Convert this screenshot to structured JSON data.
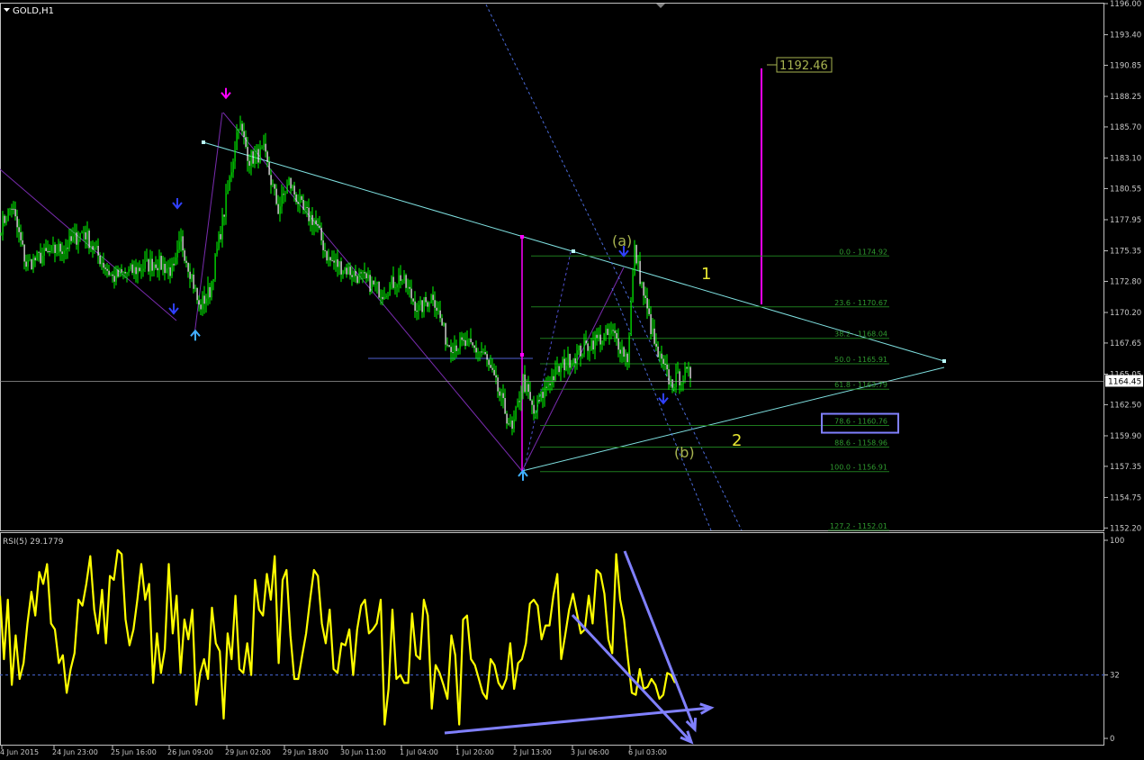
{
  "window": {
    "title": "GOLD,H1",
    "menu_icon": "triangle-down-icon"
  },
  "colors": {
    "background": "#000000",
    "frame": "#c0c0c0",
    "text": "#c8c8c8",
    "candle_bull": "#00ff00",
    "candle_bear": "#ffffff",
    "trendline": "#7fe0e0",
    "fib": "#1e7a1e",
    "fib_text": "#2f9a2f",
    "magenta": "#ff00ff",
    "rsi": "#ffff00",
    "arrow_blue": "#8080ff",
    "label_yellow": "#e8e832",
    "label_olive": "#a8b450"
  },
  "chart_data": [
    {
      "type": "candlestick",
      "symbol": "GOLD",
      "timeframe": "H1",
      "ylim": [
        1152.0,
        1196.0
      ],
      "y_ticks": [
        "1196.00",
        "1193.40",
        "1190.85",
        "1188.25",
        "1185.70",
        "1183.10",
        "1180.55",
        "1177.95",
        "1175.35",
        "1172.80",
        "1170.20",
        "1167.65",
        "1165.05",
        "1162.50",
        "1159.90",
        "1157.35",
        "1154.75",
        "1152.20"
      ],
      "x_ticks": [
        "4 Jun 2015",
        "24 Jun 23:00",
        "25 Jun 16:00",
        "26 Jun 09:00",
        "29 Jun 02:00",
        "29 Jun 18:00",
        "30 Jun 11:00",
        "1 Jul 04:00",
        "1 Jul 20:00",
        "2 Jul 13:00",
        "3 Jul 06:00",
        "6 Jul 03:00"
      ],
      "current_price": "1164.45",
      "current_price_value": 1164.45,
      "close_anchors": [
        [
          0,
          1177.4
        ],
        [
          6,
          1179.1
        ],
        [
          14,
          1174.2
        ],
        [
          24,
          1175.0
        ],
        [
          36,
          1175.7
        ],
        [
          46,
          1177.0
        ],
        [
          52,
          1175.4
        ],
        [
          62,
          1173.1
        ],
        [
          74,
          1173.7
        ],
        [
          86,
          1174.4
        ],
        [
          96,
          1173.6
        ],
        [
          100,
          1176.2
        ],
        [
          106,
          1173.2
        ],
        [
          110,
          1170.6
        ],
        [
          116,
          1172.0
        ],
        [
          126,
          1180.3
        ],
        [
          132,
          1186.1
        ],
        [
          138,
          1183.0
        ],
        [
          146,
          1183.6
        ],
        [
          154,
          1178.8
        ],
        [
          160,
          1181.1
        ],
        [
          168,
          1178.6
        ],
        [
          174,
          1177.9
        ],
        [
          182,
          1174.6
        ],
        [
          192,
          1173.8
        ],
        [
          202,
          1172.9
        ],
        [
          212,
          1171.9
        ],
        [
          222,
          1173.2
        ],
        [
          232,
          1170.4
        ],
        [
          240,
          1171.7
        ],
        [
          248,
          1167.6
        ],
        [
          258,
          1167.5
        ],
        [
          268,
          1166.8
        ],
        [
          276,
          1163.7
        ],
        [
          284,
          1160.2
        ],
        [
          290,
          1164.6
        ],
        [
          296,
          1161.7
        ],
        [
          304,
          1164.4
        ],
        [
          312,
          1165.8
        ],
        [
          322,
          1167.0
        ],
        [
          330,
          1167.9
        ],
        [
          340,
          1168.4
        ],
        [
          348,
          1166.4
        ],
        [
          352,
          1175.4
        ],
        [
          358,
          1171.0
        ],
        [
          364,
          1166.9
        ],
        [
          372,
          1164.3
        ],
        [
          380,
          1165.0
        ]
      ],
      "bar_count": 384,
      "fib_levels": [
        {
          "value": 1174.92,
          "label": "0.0 - 1174.92"
        },
        {
          "value": 1170.67,
          "label": "23.6 - 1170.67"
        },
        {
          "value": 1168.04,
          "label": "38.2 - 1168.04"
        },
        {
          "value": 1165.91,
          "label": "50.0 - 1165.91"
        },
        {
          "value": 1163.79,
          "label": "61.8 - 1163.79"
        },
        {
          "value": 1160.76,
          "label": "78.6 - 1160.76"
        },
        {
          "value": 1158.96,
          "label": "88.6 - 1158.96"
        },
        {
          "value": 1156.91,
          "label": "100.0 - 1156.91"
        },
        {
          "value": 1152.01,
          "label": "127.2 - 1152.01"
        }
      ],
      "highlighted_fib": "78.6 - 1160.76",
      "target_label": "1192.46",
      "target_value": 1192.46,
      "wave_labels": [
        "(a)",
        "1",
        "(b)",
        "2"
      ],
      "arrows": [
        {
          "type": "down",
          "bar": 98,
          "price": 1179.0,
          "color": "#3040ff"
        },
        {
          "type": "down",
          "bar": 96,
          "price": 1170.2,
          "color": "#3040ff"
        },
        {
          "type": "up",
          "bar": 108,
          "price": 1168.6,
          "color": "#40b0ff"
        },
        {
          "type": "down",
          "bar": 125,
          "price": 1188.2,
          "color": "#ff00ff"
        },
        {
          "type": "up",
          "bar": 290,
          "price": 1156.9,
          "color": "#40b0ff"
        },
        {
          "type": "down",
          "bar": 346,
          "price": 1175.0,
          "color": "#3040ff"
        },
        {
          "type": "down",
          "bar": 368,
          "price": 1162.7,
          "color": "#3040ff"
        }
      ]
    },
    {
      "type": "line",
      "title": "RSI(5) 29.1779",
      "ylim": [
        0,
        100
      ],
      "y_ticks": [
        "100",
        "32",
        "0"
      ],
      "level": 32,
      "values": [
        72,
        40,
        70,
        27,
        52,
        30,
        38,
        58,
        74,
        62,
        84,
        78,
        88,
        58,
        55,
        38,
        42,
        23,
        35,
        43,
        70,
        67,
        78,
        92,
        65,
        53,
        75,
        48,
        82,
        80,
        95,
        93,
        60,
        47,
        55,
        70,
        88,
        70,
        78,
        28,
        53,
        33,
        45,
        88,
        53,
        72,
        33,
        60,
        50,
        65,
        17,
        33,
        40,
        30,
        66,
        48,
        44,
        10,
        53,
        40,
        72,
        35,
        33,
        48,
        32,
        80,
        65,
        62,
        83,
        70,
        92,
        38,
        80,
        85,
        52,
        30,
        30,
        42,
        53,
        70,
        85,
        82,
        58,
        48,
        65,
        35,
        33,
        48,
        47,
        55,
        32,
        55,
        67,
        70,
        53,
        55,
        58,
        70,
        7,
        25,
        65,
        30,
        32,
        28,
        28,
        63,
        42,
        40,
        70,
        62,
        15,
        37,
        33,
        27,
        20,
        52,
        42,
        7,
        60,
        62,
        40,
        37,
        30,
        23,
        20,
        40,
        37,
        28,
        25,
        30,
        48,
        25,
        38,
        40,
        48,
        68,
        70,
        67,
        50,
        57,
        57,
        72,
        83,
        40,
        52,
        65,
        73,
        63,
        53,
        55,
        72,
        58,
        85,
        83,
        73,
        50,
        43,
        93,
        70,
        60,
        40,
        23,
        22,
        35,
        25,
        26,
        30,
        27,
        20,
        22,
        33,
        32,
        28
      ]
    }
  ],
  "annotations": {
    "rsi_divergence_arrows": 3,
    "target_price": "1192.46"
  }
}
